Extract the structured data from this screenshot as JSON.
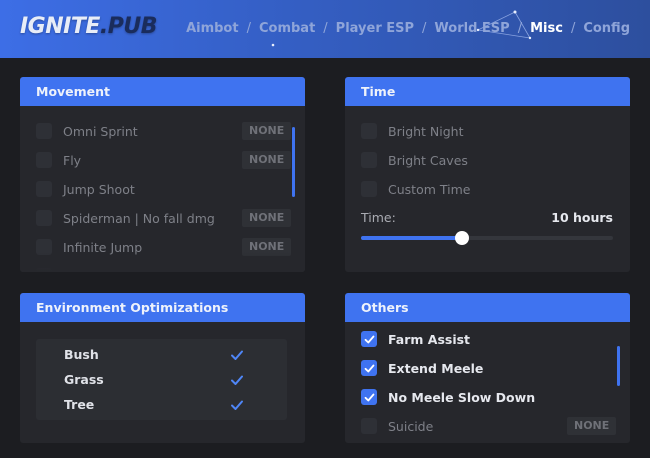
{
  "app": {
    "logo_main": "IGNITE",
    "logo_suffix": ".PUB"
  },
  "nav": {
    "tabs": [
      {
        "label": "Aimbot",
        "active": false
      },
      {
        "label": "Combat",
        "active": false
      },
      {
        "label": "Player ESP",
        "active": false
      },
      {
        "label": "World ESP",
        "active": false
      },
      {
        "label": "Misc",
        "active": true
      },
      {
        "label": "Config",
        "active": false
      }
    ],
    "separator": "/"
  },
  "movement": {
    "title": "Movement",
    "items": [
      {
        "label": "Omni Sprint",
        "checked": false,
        "keybind": "NONE"
      },
      {
        "label": "Fly",
        "checked": false,
        "keybind": "NONE"
      },
      {
        "label": "Jump Shoot",
        "checked": false,
        "keybind": ""
      },
      {
        "label": "Spiderman | No fall dmg",
        "checked": false,
        "keybind": "NONE"
      },
      {
        "label": "Infinite Jump",
        "checked": false,
        "keybind": "NONE"
      }
    ]
  },
  "time": {
    "title": "Time",
    "items": [
      {
        "label": "Bright Night",
        "checked": false
      },
      {
        "label": "Bright Caves",
        "checked": false
      },
      {
        "label": "Custom Time",
        "checked": false
      }
    ],
    "slider_label": "Time:",
    "slider_value": "10 hours",
    "slider_fraction": 0.4
  },
  "environment": {
    "title": "Environment Optimizations",
    "items": [
      {
        "label": "Bush",
        "checked": true
      },
      {
        "label": "Grass",
        "checked": true
      },
      {
        "label": "Tree",
        "checked": true
      }
    ]
  },
  "others": {
    "title": "Others",
    "items": [
      {
        "label": "Farm Assist",
        "checked": true,
        "keybind": ""
      },
      {
        "label": "Extend Meele",
        "checked": true,
        "keybind": ""
      },
      {
        "label": "No Meele Slow Down",
        "checked": true,
        "keybind": ""
      },
      {
        "label": "Suicide",
        "checked": false,
        "keybind": "NONE"
      }
    ]
  },
  "colors": {
    "accent": "#3f73f0",
    "background": "#1c1d21",
    "panel": "#26272c"
  }
}
